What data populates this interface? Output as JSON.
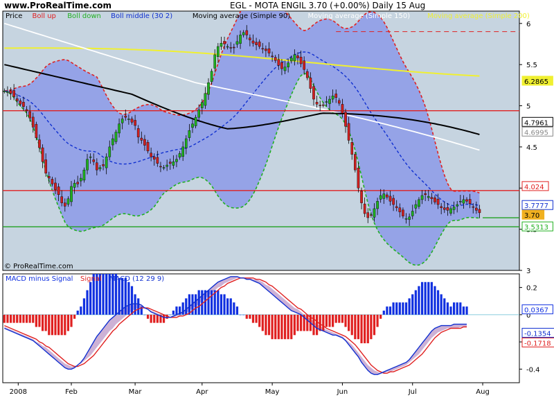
{
  "header": {
    "site": "www.ProRealTime.com",
    "title": "EGL - MOTA ENGIL    3.70 (+0.00%)    Daily  15 Aug"
  },
  "watermark": "© ProRealTime.com",
  "colors": {
    "panel_bg": "#c6d4e0",
    "band_fill": "#8c9ae8",
    "boll_up": "#e02020",
    "boll_down": "#20b020",
    "boll_mid": "#1030d0",
    "ma90": "#000000",
    "ma150": "#ffffff",
    "ma200": "#f0f030",
    "candle_up": "#20b020",
    "candle_down": "#d02020",
    "macd_hist": "#1030e0",
    "macd_hist_neg": "#e02020",
    "signal": "#e02020",
    "macd_line": "#1030d0",
    "res_line": "#e02020",
    "sup_line": "#20a020"
  },
  "chart_data": [
    {
      "type": "candlestick",
      "title": "Price",
      "legend": [
        {
          "label": "Price",
          "color": "#000000"
        },
        {
          "label": "Boll up",
          "color": "#e02020"
        },
        {
          "label": "Boll down",
          "color": "#20b020"
        },
        {
          "label": "Boll middle (30 2)",
          "color": "#1030d0"
        },
        {
          "label": "Moving average (Simple 90)",
          "color": "#000000"
        },
        {
          "label": "Moving average (Simple 150)",
          "color": "#ffffff"
        },
        {
          "label": "Moving average (Simple 200)",
          "color": "#f0f030"
        }
      ],
      "legend_placement": "top-left",
      "ylim": [
        3,
        6.15
      ],
      "y_ticks": [
        3,
        3.5,
        4,
        4.5,
        5,
        5.5,
        6
      ],
      "x_ticks": [
        "2008",
        "Feb",
        "Mar",
        "Apr",
        "May",
        "Jun",
        "Jul",
        "Aug"
      ],
      "grid": false,
      "x_days": 162,
      "closes": [
        5.18,
        5.17,
        5.15,
        5.11,
        5.06,
        5.02,
        4.99,
        4.94,
        4.85,
        4.74,
        4.61,
        4.49,
        4.32,
        4.18,
        4.12,
        4.05,
        3.98,
        3.92,
        3.82,
        3.78,
        3.87,
        4.02,
        4.06,
        4.05,
        4.12,
        4.22,
        4.35,
        4.38,
        4.32,
        4.22,
        4.25,
        4.27,
        4.38,
        4.5,
        4.6,
        4.68,
        4.78,
        4.84,
        4.86,
        4.84,
        4.8,
        4.76,
        4.62,
        4.58,
        4.52,
        4.45,
        4.38,
        4.35,
        4.3,
        4.26,
        4.25,
        4.28,
        4.3,
        4.32,
        4.35,
        4.42,
        4.5,
        4.6,
        4.7,
        4.78,
        4.86,
        4.95,
        5.04,
        5.15,
        5.28,
        5.42,
        5.62,
        5.72,
        5.76,
        5.75,
        5.72,
        5.7,
        5.71,
        5.78,
        5.86,
        5.89,
        5.86,
        5.8,
        5.76,
        5.74,
        5.72,
        5.69,
        5.67,
        5.64,
        5.6,
        5.55,
        5.49,
        5.45,
        5.47,
        5.52,
        5.58,
        5.62,
        5.58,
        5.51,
        5.44,
        5.34,
        5.21,
        5.08,
        5.02,
        5.0,
        5.01,
        5.05,
        5.08,
        5.12,
        5.1,
        5.03,
        4.91,
        4.75,
        4.58,
        4.41,
        4.22,
        4.0,
        3.82,
        3.69,
        3.64,
        3.67,
        3.75,
        3.84,
        3.91,
        3.93,
        3.89,
        3.84,
        3.8,
        3.76,
        3.71,
        3.66,
        3.63,
        3.65,
        3.72,
        3.8,
        3.86,
        3.91,
        3.92,
        3.9,
        3.87,
        3.83,
        3.8,
        3.76,
        3.74,
        3.73,
        3.75,
        3.77,
        3.8,
        3.84,
        3.86,
        3.84,
        3.81,
        3.77,
        3.73,
        3.7
      ],
      "last_values": [
        {
          "text": "6.2865",
          "value": 5.3,
          "color": "#f0f030"
        },
        {
          "text": "4.7961",
          "value": 4.8,
          "color": "#000000"
        },
        {
          "text": "4.6995",
          "value": 4.7,
          "color": "#ffffff"
        },
        {
          "text": "4.024",
          "value": 4.02,
          "color": "#e02020"
        },
        {
          "text": "3.7777",
          "value": 3.79,
          "color": "#1030d0"
        },
        {
          "text": "3.70",
          "value": 3.7,
          "color": "#f0b020"
        },
        {
          "text": "3.5313",
          "value": 3.53,
          "color": "#20b020"
        }
      ],
      "horizontal_lines": [
        {
          "value": 5.9,
          "color": "#e02020",
          "style": "dashed",
          "from_day": 104
        },
        {
          "value": 4.94,
          "color": "#e02020",
          "style": "solid"
        },
        {
          "value": 3.97,
          "color": "#e02020",
          "style": "solid"
        },
        {
          "value": 3.53,
          "color": "#20a020",
          "style": "solid"
        },
        {
          "value": 3.64,
          "color": "#20a020",
          "style": "solid",
          "from_day": 150
        }
      ]
    },
    {
      "type": "bar",
      "title": "MACD",
      "legend": [
        {
          "label": "MACD minus Signal",
          "color": "#1030e0"
        },
        {
          "label": "Signal",
          "color": "#e02020"
        },
        {
          "label": "MACD (12 29 9)",
          "color": "#1030d0"
        }
      ],
      "legend_placement": "top-left",
      "ylim": [
        -0.5,
        0.3
      ],
      "y_ticks": [
        0.2,
        0,
        -0.2,
        -0.4
      ],
      "macd_line": [
        -0.1,
        -0.11,
        -0.12,
        -0.13,
        -0.14,
        -0.15,
        -0.16,
        -0.17,
        -0.18,
        -0.19,
        -0.21,
        -0.23,
        -0.25,
        -0.27,
        -0.29,
        -0.31,
        -0.33,
        -0.35,
        -0.37,
        -0.39,
        -0.4,
        -0.4,
        -0.39,
        -0.37,
        -0.35,
        -0.32,
        -0.28,
        -0.24,
        -0.2,
        -0.16,
        -0.13,
        -0.1,
        -0.07,
        -0.04,
        -0.02,
        0.0,
        0.02,
        0.04,
        0.06,
        0.07,
        0.08,
        0.08,
        0.08,
        0.07,
        0.05,
        0.04,
        0.02,
        0.01,
        0.0,
        -0.01,
        -0.02,
        -0.02,
        -0.02,
        -0.01,
        0.0,
        0.01,
        0.02,
        0.04,
        0.06,
        0.08,
        0.1,
        0.12,
        0.14,
        0.16,
        0.18,
        0.2,
        0.22,
        0.24,
        0.25,
        0.26,
        0.27,
        0.28,
        0.28,
        0.28,
        0.27,
        0.27,
        0.26,
        0.26,
        0.25,
        0.24,
        0.23,
        0.21,
        0.19,
        0.17,
        0.15,
        0.13,
        0.11,
        0.09,
        0.07,
        0.05,
        0.03,
        0.02,
        0.01,
        0.0,
        -0.02,
        -0.04,
        -0.06,
        -0.08,
        -0.1,
        -0.11,
        -0.12,
        -0.13,
        -0.14,
        -0.15,
        -0.15,
        -0.16,
        -0.17,
        -0.19,
        -0.22,
        -0.25,
        -0.28,
        -0.31,
        -0.35,
        -0.38,
        -0.41,
        -0.43,
        -0.44,
        -0.44,
        -0.43,
        -0.42,
        -0.41,
        -0.4,
        -0.39,
        -0.38,
        -0.37,
        -0.36,
        -0.35,
        -0.33,
        -0.3,
        -0.27,
        -0.24,
        -0.21,
        -0.18,
        -0.15,
        -0.12,
        -0.1,
        -0.09,
        -0.08,
        -0.08,
        -0.08,
        -0.08,
        -0.07,
        -0.07,
        -0.07,
        -0.07,
        -0.07
      ],
      "signal_line": [
        -0.08,
        -0.09,
        -0.1,
        -0.11,
        -0.12,
        -0.13,
        -0.14,
        -0.15,
        -0.16,
        -0.17,
        -0.18,
        -0.2,
        -0.21,
        -0.23,
        -0.24,
        -0.26,
        -0.28,
        -0.3,
        -0.32,
        -0.34,
        -0.36,
        -0.37,
        -0.38,
        -0.38,
        -0.37,
        -0.36,
        -0.34,
        -0.32,
        -0.3,
        -0.27,
        -0.24,
        -0.21,
        -0.18,
        -0.15,
        -0.12,
        -0.1,
        -0.07,
        -0.05,
        -0.03,
        -0.01,
        0.01,
        0.03,
        0.04,
        0.05,
        0.05,
        0.05,
        0.04,
        0.03,
        0.02,
        0.01,
        0.0,
        -0.01,
        -0.02,
        -0.02,
        -0.02,
        -0.01,
        -0.01,
        0.0,
        0.01,
        0.03,
        0.05,
        0.06,
        0.08,
        0.1,
        0.12,
        0.14,
        0.16,
        0.18,
        0.2,
        0.21,
        0.23,
        0.24,
        0.25,
        0.26,
        0.27,
        0.27,
        0.27,
        0.27,
        0.27,
        0.26,
        0.26,
        0.25,
        0.24,
        0.22,
        0.21,
        0.19,
        0.17,
        0.15,
        0.13,
        0.11,
        0.09,
        0.07,
        0.05,
        0.04,
        0.02,
        0.0,
        -0.02,
        -0.03,
        -0.05,
        -0.07,
        -0.08,
        -0.1,
        -0.11,
        -0.12,
        -0.13,
        -0.14,
        -0.15,
        -0.16,
        -0.18,
        -0.2,
        -0.22,
        -0.25,
        -0.28,
        -0.31,
        -0.34,
        -0.37,
        -0.39,
        -0.41,
        -0.42,
        -0.43,
        -0.43,
        -0.42,
        -0.42,
        -0.41,
        -0.4,
        -0.39,
        -0.38,
        -0.37,
        -0.35,
        -0.33,
        -0.31,
        -0.29,
        -0.26,
        -0.23,
        -0.2,
        -0.17,
        -0.15,
        -0.13,
        -0.12,
        -0.11,
        -0.1,
        -0.1,
        -0.1,
        -0.1,
        -0.09,
        -0.09,
        -0.09
      ],
      "last_values": [
        {
          "text": "0.0367",
          "value": 0.0367,
          "color": "#1030e0"
        },
        {
          "text": "-0.1354",
          "value": -0.1354,
          "color": "#1030d0"
        },
        {
          "text": "-0.1718",
          "value": -0.1718,
          "color": "#e02020"
        }
      ]
    }
  ]
}
